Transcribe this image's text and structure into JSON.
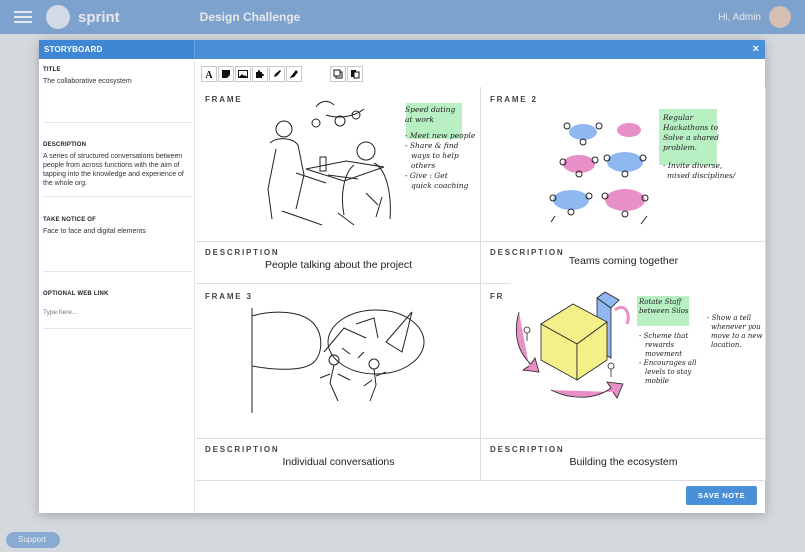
{
  "background": {
    "brand": "sprint",
    "title": "Design Challenge",
    "user": "Hi, Admin",
    "support": "Support"
  },
  "modal": {
    "title": "STORYBOARD",
    "close": "×"
  },
  "sidebar": {
    "title_label": "TITLE",
    "title_value": "The collaborative ecosystem",
    "description_label": "DESCRIPTION",
    "description_value": "A series of structured conversations between people from across functions with the aim of tapping into the knowledge and experience of the whole org.",
    "notice_label": "TAKE NOTICE OF",
    "notice_value": "Face to face and digital elements",
    "link_label": "OPTIONAL WEB LINK",
    "link_placeholder": "Type here..."
  },
  "frames": [
    {
      "label": "FRAME",
      "description_label": "DESCRIPTION",
      "description": "People talking about the project"
    },
    {
      "label": "FRAME 2",
      "description_label": "DESCRIPTION",
      "description": "Teams coming together"
    },
    {
      "label": "FRAME 3",
      "description_label": "DESCRIPTION",
      "description": "Individual conversations"
    },
    {
      "label": "FR",
      "description_label": "DESCRIPTION",
      "description": "Building the ecosystem"
    }
  ],
  "sketch_notes": {
    "f1": [
      "Speed dating",
      "at work",
      "- Meet new people",
      "- Share & find",
      "ways to help",
      "others",
      "- Give : Get",
      "quick coaching"
    ],
    "f2": [
      "Regular",
      "Hackathons to",
      "Solve a shared",
      "problem.",
      "- Invite diverse,",
      "mixed disciplines/"
    ],
    "f4a": [
      "Rotate Staff",
      "between Silos"
    ],
    "f4b": [
      "- Scheme that",
      "rewards",
      "movement",
      "- Encourages all",
      "levels to stay",
      "mobile"
    ],
    "f4c": [
      "- Show a tell",
      "whenever you",
      "move to a new",
      "location."
    ]
  },
  "colors": {
    "accent": "#4a90d9",
    "sticky": "#b8f0c4",
    "pink": "#e98fc8",
    "blue": "#8fb8f0",
    "yellow": "#f3f08a"
  },
  "actions": {
    "save_label": "SAVE NOTE"
  }
}
